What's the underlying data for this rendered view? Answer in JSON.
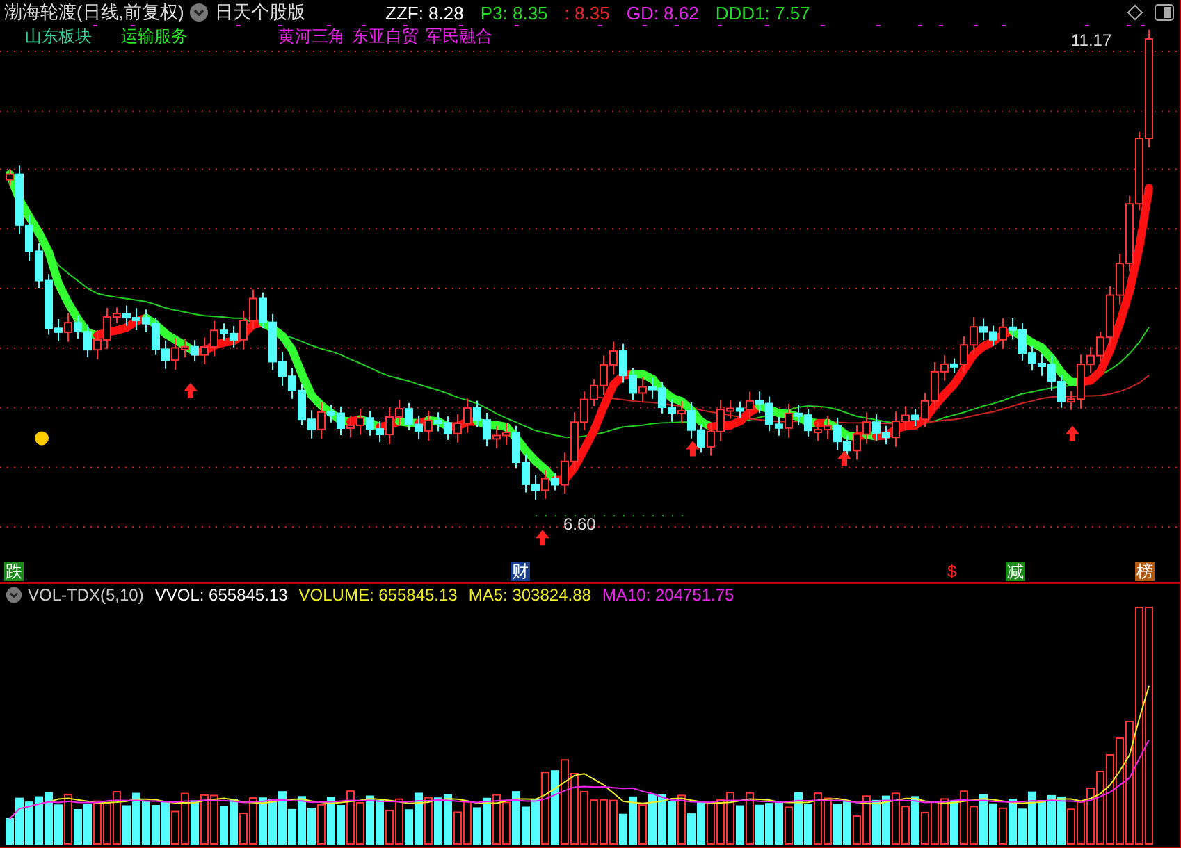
{
  "header": {
    "stock_name": "渤海轮渡(日线,前复权)",
    "version": "日天个股版",
    "indicators": [
      {
        "label": "ZZF: 8.28",
        "color": "#ffffff"
      },
      {
        "label": "P3: 8.35",
        "color": "#22dd22"
      },
      {
        "label": ": 8.35",
        "color": "#ee2222"
      },
      {
        "label": "GD: 8.62",
        "color": "#ee22ee"
      },
      {
        "label": "DDD1: 7.57",
        "color": "#22dd22"
      }
    ]
  },
  "sectors": [
    {
      "label": "山东板块",
      "color": "#33cc99"
    },
    {
      "label": "运输服务",
      "color": "#22ee22"
    },
    {
      "label": "黄河三角",
      "color": "#ee22ee"
    },
    {
      "label": "东亚自贸",
      "color": "#ee22ee"
    },
    {
      "label": "军民融合",
      "color": "#ee22ee"
    }
  ],
  "price_labels": {
    "high": "11.17",
    "low": "6.60"
  },
  "event_markers": [
    {
      "label": "跌",
      "color": "#1a8a1a"
    },
    {
      "label": "财",
      "color": "#1a3f8a"
    },
    {
      "label": "$",
      "color": "#000000"
    },
    {
      "label": "减",
      "color": "#1a8a1a"
    },
    {
      "label": "榜",
      "color": "#b05a10"
    }
  ],
  "volume_panel": {
    "title": "VOL-TDX(5,10)",
    "readings": [
      {
        "label": "VVOL: 655845.13",
        "color": "#ffffff"
      },
      {
        "label": "VOLUME: 655845.13",
        "color": "#eeee22"
      },
      {
        "label": "MA5: 303824.88",
        "color": "#eeee22"
      },
      {
        "label": "MA10: 204751.75",
        "color": "#ee22ee"
      }
    ]
  }
}
